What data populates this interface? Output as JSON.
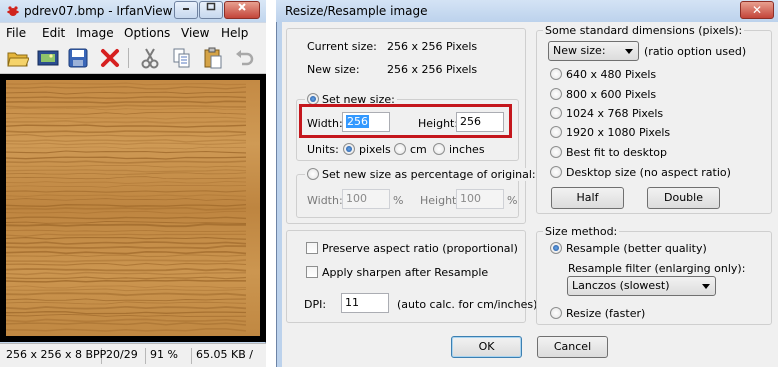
{
  "irfanview": {
    "title": "pdrev07.bmp - IrfanView (...",
    "menu": [
      "File",
      "Edit",
      "Image",
      "Options",
      "View",
      "Help"
    ],
    "toolbar_icons": [
      "open-folder-icon",
      "slideshow-icon",
      "save-icon",
      "delete-icon",
      "cut-icon",
      "copy-icon",
      "paste-icon",
      "undo-icon"
    ],
    "status": {
      "dimensions": "256 x 256 x 8 BPP",
      "index": "20/29",
      "zoom": "91 %",
      "filesize": "65.05 KB /"
    },
    "colors": {
      "wood_light": "#c9934a",
      "wood_dark": "#9a6427"
    }
  },
  "dialog": {
    "title": "Resize/Resample image",
    "close_label": "✕",
    "current_size_label": "Current size:",
    "current_size_value": "256  x  256  Pixels",
    "new_size_label": "New size:",
    "new_size_value": "256  x  256  Pixels",
    "set_new_size_label": "Set new size:",
    "width_label": "Width:",
    "width_value": "256",
    "height_label": "Height:",
    "height_value": "256",
    "units_label": "Units:",
    "unit_pixels": "pixels",
    "unit_cm": "cm",
    "unit_inches": "inches",
    "percent_label": "Set new size as percentage of original:",
    "pct_width_label": "Width:",
    "pct_width_value": "100",
    "pct_height_label": "Height:",
    "pct_height_value": "100",
    "percent_sign": "%",
    "preserve_aspect": "Preserve aspect ratio (proportional)",
    "apply_sharpen": "Apply sharpen after Resample",
    "dpi_label": "DPI:",
    "dpi_value": "11",
    "dpi_note": "(auto calc. for cm/inches)",
    "standard_dims_title": "Some standard dimensions (pixels):",
    "new_size_combo": "New size:",
    "ratio_note": "(ratio option used)",
    "std_options": [
      "640 x 480 Pixels",
      "800 x 600 Pixels",
      "1024 x 768 Pixels",
      "1920 x 1080 Pixels",
      "Best fit to desktop",
      "Desktop size (no aspect ratio)"
    ],
    "half_label": "Half",
    "double_label": "Double",
    "size_method_title": "Size method:",
    "resample_label": "Resample (better quality)",
    "resample_filter_label": "Resample filter (enlarging only):",
    "filter_value": "Lanczos (slowest)",
    "resize_label": "Resize (faster)",
    "ok_label": "OK",
    "cancel_label": "Cancel",
    "highlight_color": "#c4161c"
  }
}
